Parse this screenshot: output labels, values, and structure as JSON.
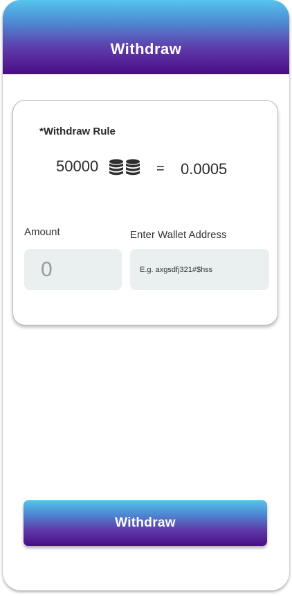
{
  "header": {
    "title": "Withdraw"
  },
  "rule_card": {
    "title": "*Withdraw Rule",
    "coin_amount": "50000",
    "coins_icon": "coin-stack-icon",
    "equals": "=",
    "converted_amount": "0.0005"
  },
  "form": {
    "amount_label": "Amount",
    "amount_placeholder": "0",
    "wallet_label": "Enter Wallet Address",
    "wallet_placeholder": "E.g. axgsdfj321#$hss"
  },
  "actions": {
    "withdraw_label": "Withdraw"
  },
  "colors": {
    "gradient_top": "#54c5ec",
    "gradient_bottom": "#4a0d84",
    "input_bg": "#eaefef"
  }
}
